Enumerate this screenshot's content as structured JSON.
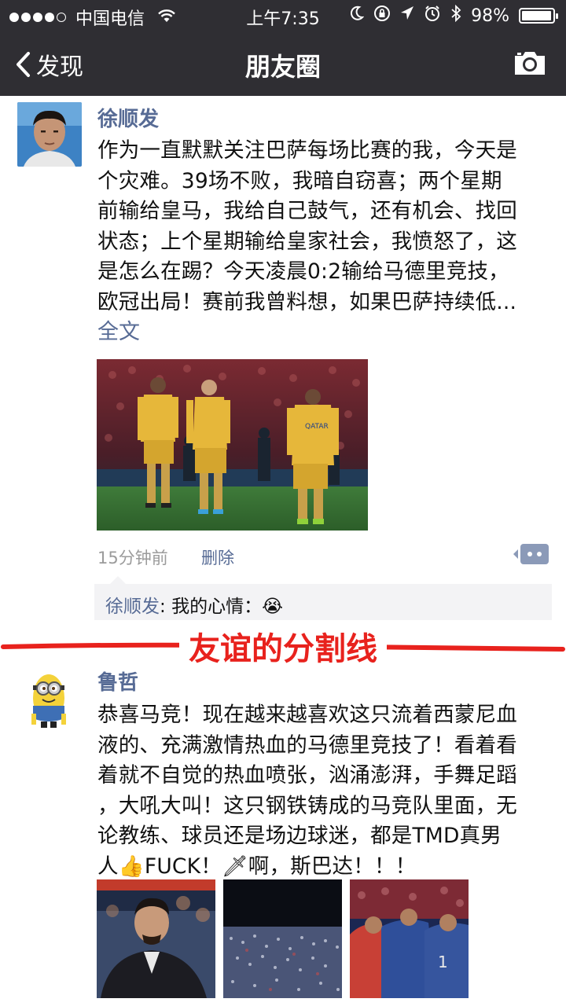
{
  "status_bar": {
    "carrier": "中国电信",
    "time": "上午7:35",
    "battery_percent": "98%",
    "battery_level": 0.98
  },
  "nav": {
    "back_label": "发现",
    "title": "朋友圈"
  },
  "post1": {
    "username": "徐顺发",
    "lines": [
      "作为一直默默关注巴萨每场比赛的我，今天是",
      "个灾难。39场不败，我暗自窃喜；两个星期",
      "前输给皇马，我给自己鼓气，还有机会、找回",
      "状态；上个星期输给皇家社会，我愤怒了，这",
      "是怎么在踢？今天凌晨0:2输给马德里竞技，",
      "欧冠出局！赛前我曾料想，如果巴萨持续低..."
    ],
    "full_text_link": "全文",
    "time": "15分钟前",
    "delete_label": "删除",
    "comment": {
      "name": "徐顺发",
      "separator": ": ",
      "text": "我的心情：",
      "emoji": "😭"
    }
  },
  "divider": {
    "label": "友谊的分割线"
  },
  "post2": {
    "username": "鲁哲",
    "lines": [
      "恭喜马竞！现在越来越喜欢这只流着西蒙尼血",
      "液的、充满激情热血的马德里竞技了！看着看",
      "着就不自觉的热血喷张，汹涌澎湃，手舞足蹈",
      "，大吼大叫！这只钢铁铸成的马竞队里面，无",
      "论教练、球员还是场边球迷，都是TMD真男",
      "人👍FUCK！🗡啊，斯巴达！！！"
    ]
  }
}
